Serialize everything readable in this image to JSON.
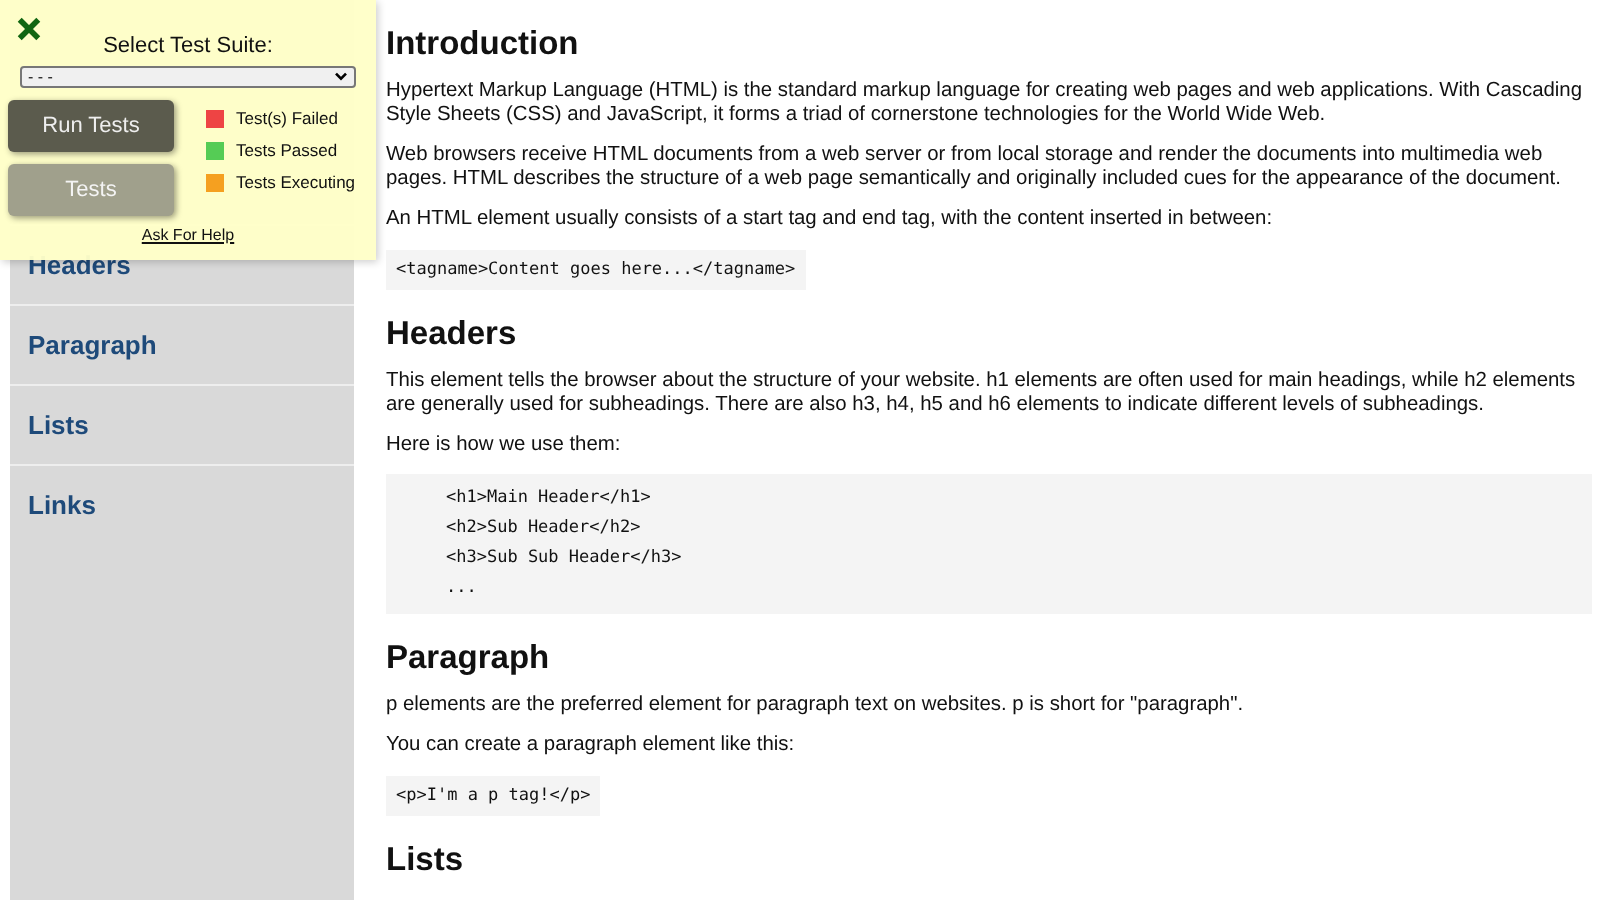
{
  "test_panel": {
    "title": "Select Test Suite:",
    "suite_select": {
      "value": "- - -"
    },
    "buttons": [
      {
        "label": "Run Tests",
        "disabled": false
      },
      {
        "label": "Tests",
        "disabled": true
      }
    ],
    "legend": [
      {
        "label": "Test(s) Failed",
        "color": "#ee4444"
      },
      {
        "label": "Tests Passed",
        "color": "#55cc55"
      },
      {
        "label": "Tests Executing",
        "color": "#f5a020"
      }
    ],
    "help_link": "Ask For Help"
  },
  "sidebar": {
    "items": [
      "Headers",
      "Paragraph",
      "Lists",
      "Links"
    ]
  },
  "sections": [
    {
      "heading": "Introduction",
      "blocks": [
        {
          "kind": "text",
          "text": "Hypertext Markup Language (HTML) is the standard markup language for creating web pages and web applications. With Cascading Style Sheets (CSS) and JavaScript, it forms a triad of cornerstone technologies for the World Wide Web."
        },
        {
          "kind": "text",
          "text": "Web browsers receive HTML documents from a web server or from local storage and render the documents into multimedia web pages. HTML describes the structure of a web page semantically and originally included cues for the appearance of the document."
        },
        {
          "kind": "text",
          "text": "An HTML element usually consists of a start tag and end tag, with the content inserted in between:"
        },
        {
          "kind": "code",
          "lines": [
            "<tagname>Content goes here...</tagname>"
          ]
        }
      ]
    },
    {
      "heading": "Headers",
      "blocks": [
        {
          "kind": "text",
          "text": "This element tells the browser about the structure of your website. h1 elements are often used for main headings, while h2 elements are generally used for subheadings. There are also h3, h4, h5 and h6 elements to indicate different levels of subheadings."
        },
        {
          "kind": "text",
          "text": "Here is how we use them:"
        },
        {
          "kind": "codeblock",
          "lines": [
            "<h1>Main Header</h1>",
            "<h2>Sub Header</h2>",
            "<h3>Sub Sub Header</h3>",
            "..."
          ]
        }
      ]
    },
    {
      "heading": "Paragraph",
      "blocks": [
        {
          "kind": "text",
          "text": "p elements are the preferred element for paragraph text on websites. p is short for \"paragraph\"."
        },
        {
          "kind": "text",
          "text": "You can create a paragraph element like this:"
        },
        {
          "kind": "code",
          "lines": [
            "<p>I'm a p tag!</p>"
          ]
        }
      ]
    },
    {
      "heading": "Lists"
    }
  ]
}
